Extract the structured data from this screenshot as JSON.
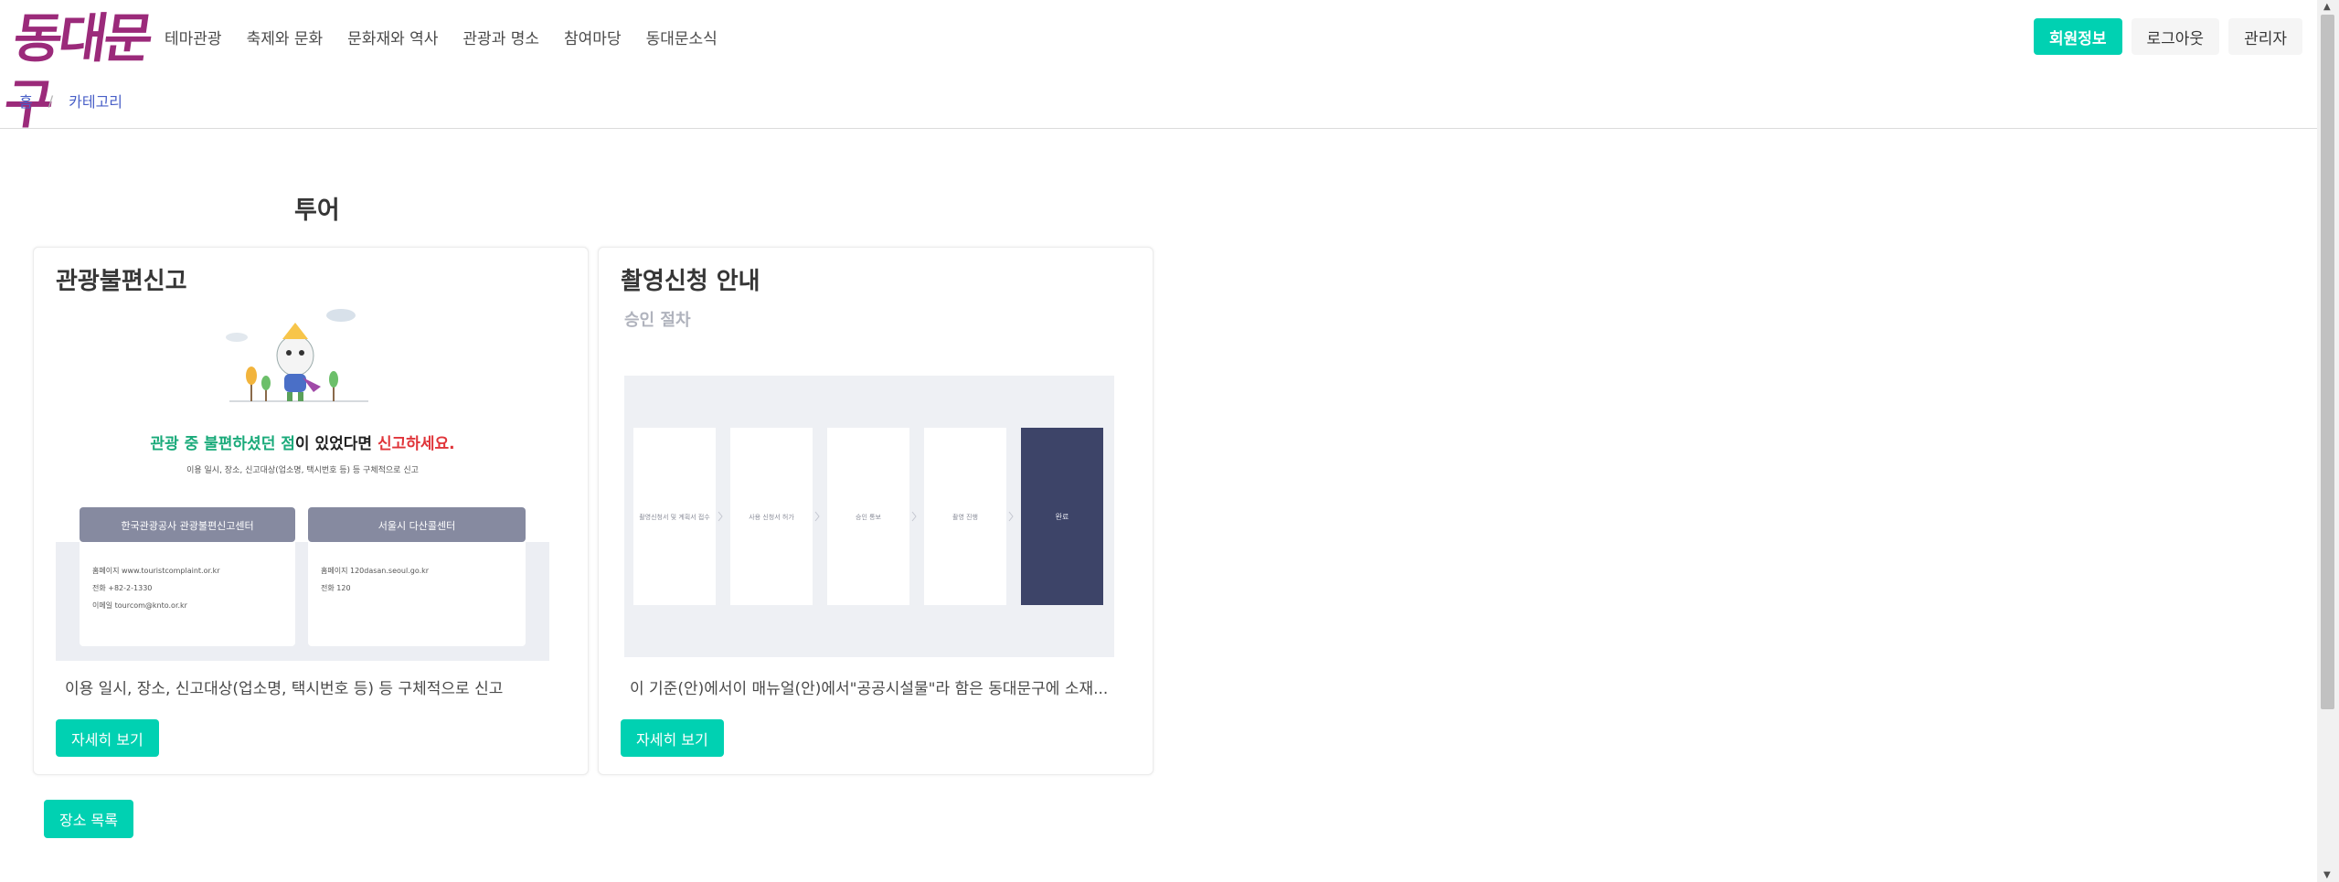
{
  "logo": {
    "text": "동대문구"
  },
  "nav": {
    "items": [
      {
        "label": "테마관광"
      },
      {
        "label": "축제와 문화"
      },
      {
        "label": "문화재와 역사"
      },
      {
        "label": "관광과 명소"
      },
      {
        "label": "참여마당"
      },
      {
        "label": "동대문소식"
      }
    ],
    "member_info": "회원정보",
    "logout": "로그아웃",
    "admin": "관리자"
  },
  "breadcrumb": {
    "home": "홈",
    "separator": "/",
    "current": "카테고리"
  },
  "section": {
    "title": "투어"
  },
  "cards": [
    {
      "title": "관광불편신고",
      "description": "이용 일시, 장소, 신고대상(업소명, 택시번호 등) 등 구체적으로 신고",
      "button": "자세히 보기",
      "image": {
        "headline_part1": "관광 중 불편하셨던 점",
        "headline_part2": "이 있었다면 ",
        "headline_part3": "신고하세요.",
        "subline": "이용 일시, 장소, 신고대상(업소명, 택시번호 등) 등 구체적으로 신고",
        "box1_title": "한국관광공사 관광불편신고센터",
        "box1_lines": [
          "홈페이지  www.touristcomplaint.or.kr",
          "전화  +82-2-1330",
          "이메일  tourcom@knto.or.kr"
        ],
        "box2_title": "서울시 다산콜센터",
        "box2_lines": [
          "홈페이지  120dasan.seoul.go.kr",
          "전화  120"
        ]
      }
    },
    {
      "title": "촬영신청 안내",
      "description": "이 기준(안)에서이 매뉴얼(안)에서\"공공시설물\"라 함은 동대문구에 소재...",
      "button": "자세히 보기",
      "image": {
        "caption": "승인 절차",
        "steps": [
          "촬영신청서 및 계획서 접수",
          "사용 신청서 허가",
          "승인 통보",
          "촬영 진행",
          "완료"
        ]
      }
    }
  ],
  "footer_button": "장소 목록",
  "colors": {
    "accent": "#00d1b2",
    "link": "#485fc7",
    "logo": "#9b2a7a",
    "step_active": "#3d4468"
  }
}
